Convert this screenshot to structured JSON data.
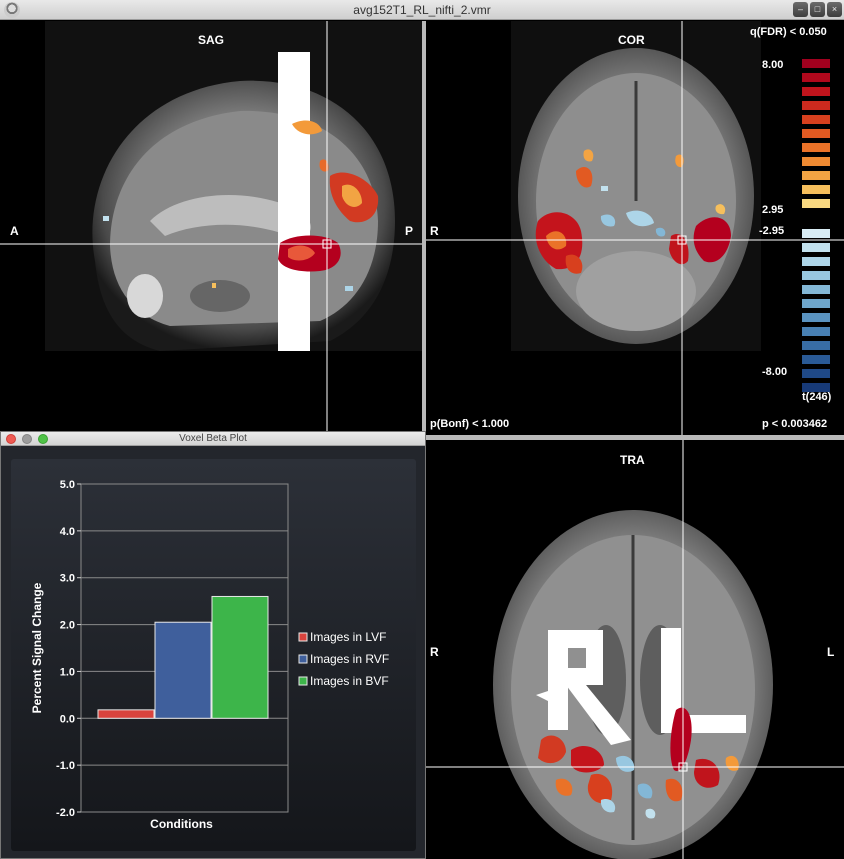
{
  "window": {
    "title": "avg152T1_RL_nifti_2.vmr",
    "app_icon": "brainvoyager-icon"
  },
  "sag_view": {
    "title": "SAG",
    "left_orientation": "A",
    "right_orientation": "P"
  },
  "cor_view": {
    "title": "COR",
    "left_orientation": "R",
    "threshold_label": "q(FDR) < 0.050",
    "colorbar": {
      "pos_max": "8.00",
      "pos_min": "2.95",
      "neg_min": "-2.95",
      "neg_max": "-8.00",
      "stat_label": "t(246)",
      "positive_colors": [
        "#a0001e",
        "#b0081c",
        "#c0141c",
        "#cc2a1e",
        "#d8401e",
        "#e25a22",
        "#ea7228",
        "#ef8a32",
        "#f3a443",
        "#f6bf5c",
        "#f8d880"
      ],
      "negative_colors": [
        "#d8ecf4",
        "#c2e1ee",
        "#add5e8",
        "#98c7e0",
        "#83b7d6",
        "#6ea6cb",
        "#5a93c0",
        "#4880b3",
        "#386da5",
        "#2a5a96",
        "#1f4987",
        "#173a78"
      ]
    },
    "bonf_label": "p(Bonf) < 1.000",
    "p_label": "p < 0.003462"
  },
  "tra_view": {
    "title": "TRA",
    "left_orientation": "R",
    "right_orientation": "L"
  },
  "beta_plot": {
    "window_title": "Voxel Beta Plot",
    "chart_data": {
      "type": "bar",
      "categories": [
        "Images in LVF",
        "Images in RVF",
        "Images in BVF"
      ],
      "values": [
        0.18,
        2.05,
        2.6
      ],
      "colors": [
        "#d9433d",
        "#3f5f9c",
        "#3db54a"
      ],
      "ylabel": "Percent Signal Change",
      "xlabel": "Conditions",
      "ylim": [
        -2.0,
        5.0
      ],
      "yticks": [
        "-2.0",
        "-1.0",
        "0.0",
        "1.0",
        "2.0",
        "3.0",
        "4.0",
        "5.0"
      ],
      "legend_position": "right",
      "grid": true
    }
  }
}
